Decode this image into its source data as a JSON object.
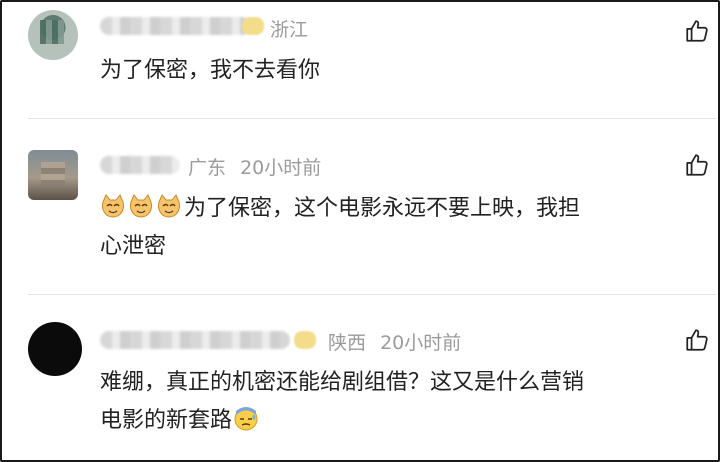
{
  "comments": [
    {
      "location": "浙江",
      "time": "",
      "text_lines": [
        "为了保密，我不去看你"
      ]
    },
    {
      "location": "广东",
      "time": "20小时前",
      "emojis": [
        "cat-face-emoji",
        "cat-face-emoji",
        "cat-face-emoji"
      ],
      "text_lines": [
        "为了保密，这个电影永远不要上映，我担",
        "心泄密"
      ]
    },
    {
      "location": "陕西",
      "time": "20小时前",
      "text_lines": [
        "难绷，真正的机密还能给剧组借？这又是什么营销",
        "电影的新套路"
      ],
      "trailing_emoji": "sweat-face-emoji"
    }
  ],
  "icons": {
    "like": "thumbs-up-icon"
  },
  "colors": {
    "meta": "#9b9b9b",
    "text": "#222222",
    "badge": "#f3dd8a"
  }
}
